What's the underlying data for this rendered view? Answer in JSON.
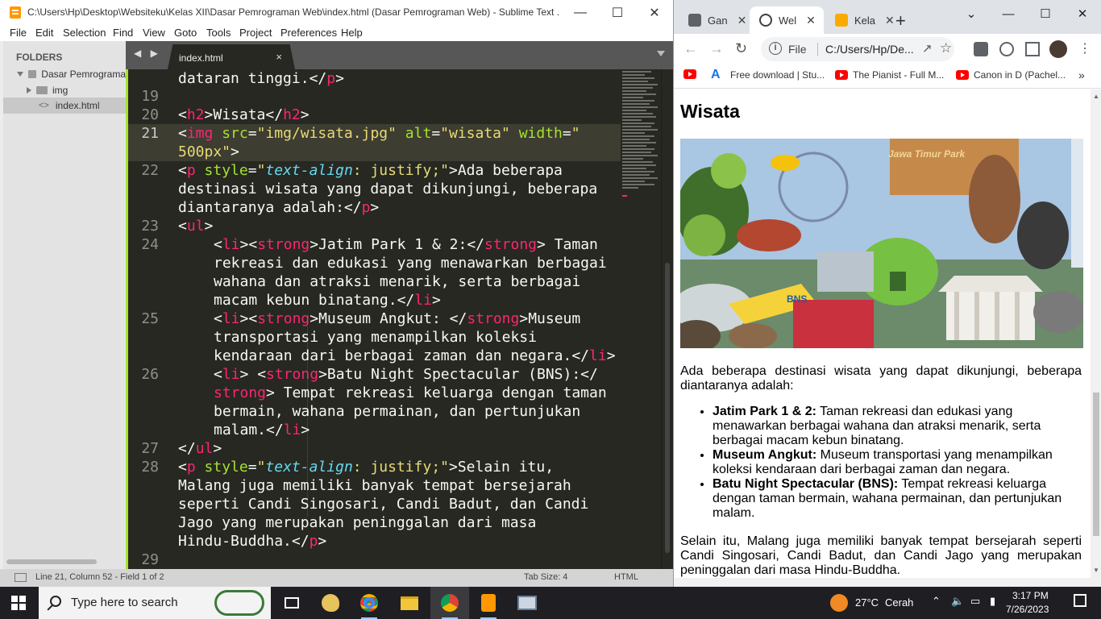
{
  "sublime": {
    "title": "C:\\Users\\Hp\\Desktop\\Websiteku\\Kelas XII\\Dasar Pemrograman Web\\index.html (Dasar Pemrograman Web) - Sublime Text ...",
    "menu": [
      "File",
      "Edit",
      "Selection",
      "Find",
      "View",
      "Goto",
      "Tools",
      "Project",
      "Preferences",
      "Help"
    ],
    "sidebar": {
      "header": "FOLDERS",
      "items": [
        {
          "label": "Dasar Pemrograma"
        },
        {
          "label": "img"
        },
        {
          "label": "index.html"
        }
      ]
    },
    "tab": {
      "label": "index.html",
      "close": "×"
    },
    "status": {
      "position": "Line 21, Column 52 - Field 1 of 2",
      "tab_size": "Tab Size: 4",
      "syntax": "HTML"
    }
  },
  "code": {
    "l0_t": "dataran tinggi.",
    "l0_c1": "</",
    "l0_c2": "p",
    "l0_c3": ">",
    "n19": "19",
    "n20": "20",
    "l20_a": "<",
    "l20_b": "h2",
    "l20_c": ">Wisata</",
    "l20_d": "h2",
    "l20_e": ">",
    "n21": "21",
    "l21_a": "<",
    "l21_b": "img",
    "l21_c": " src",
    "l21_d": "=",
    "l21_e": "\"img/wisata.jpg\"",
    "l21_f": " alt",
    "l21_g": "=",
    "l21_h": "\"wisata\"",
    "l21_i": " width",
    "l21_j": "=",
    "l21_k": "\"",
    "l21w_a": "500px\"",
    "l21w_b": ">",
    "n22": "22",
    "l22_a": "<",
    "l22_b": "p",
    "l22_c": " style",
    "l22_d": "=",
    "l22_e": "\"",
    "l22_f": "text-align",
    "l22_g": ": justify;",
    "l22_h": "\"",
    "l22_i": ">Ada beberapa",
    "l22w1": "destinasi wisata yang dapat dikunjungi, beberapa",
    "l22w2_a": "diantaranya adalah:</",
    "l22w2_b": "p",
    "l22w2_c": ">",
    "n23": "23",
    "l23_a": "<",
    "l23_b": "ul",
    "l23_c": ">",
    "n24": "24",
    "l24_a": "<",
    "l24_b": "li",
    "l24_c": "><",
    "l24_d": "strong",
    "l24_e": ">Jatim Park 1 & 2:</",
    "l24_f": "strong",
    "l24_g": "> Taman",
    "l24w1": "rekreasi dan edukasi yang menawarkan berbagai",
    "l24w2": "wahana dan atraksi menarik, serta berbagai",
    "l24w3_a": "macam kebun binatang.</",
    "l24w3_b": "li",
    "l24w3_c": ">",
    "n25": "25",
    "l25_a": "<",
    "l25_b": "li",
    "l25_c": "><",
    "l25_d": "strong",
    "l25_e": ">Museum Angkut: </",
    "l25_f": "strong",
    "l25_g": ">Museum",
    "l25w1": "transportasi yang menampilkan koleksi",
    "l25w2_a": "kendaraan dari berbagai zaman dan negara.</",
    "l25w2_b": "li",
    "l25w2_c": ">",
    "n26": "26",
    "l26_a": "<",
    "l26_b": "li",
    "l26_c": "> <",
    "l26_d": "strong",
    "l26_e": ">Batu Night Spectacular (BNS):</",
    "l26w1_a": "strong",
    "l26w1_b": "> Tempat rekreasi keluarga dengan taman",
    "l26w2": "bermain, wahana permainan, dan pertunjukan",
    "l26w3_a": "malam.</",
    "l26w3_b": "li",
    "l26w3_c": ">",
    "n27": "27",
    "l27_a": "</",
    "l27_b": "ul",
    "l27_c": ">",
    "n28": "28",
    "l28_a": "<",
    "l28_b": "p",
    "l28_c": " style",
    "l28_d": "=",
    "l28_e": "\"",
    "l28_f": "text-align",
    "l28_g": ": justify;",
    "l28_h": "\"",
    "l28_i": ">Selain itu,",
    "l28w1": "Malang juga memiliki banyak tempat bersejarah",
    "l28w2": "seperti Candi Singosari, Candi Badut, dan Candi",
    "l28w3": "Jago yang merupakan peninggalan dari masa",
    "l28w4_a": "Hindu-Buddha.</",
    "l28w4_b": "p",
    "l28w4_c": ">",
    "n29": "29"
  },
  "chrome": {
    "tabs": [
      {
        "label": "Gan",
        "favicon_color": "#5f6368"
      },
      {
        "label": "Wel",
        "favicon_color": "#3c4043"
      },
      {
        "label": "Kela",
        "favicon_color": "#f9ab00"
      }
    ],
    "new_tab": "+",
    "address": {
      "scheme": "File",
      "url": "C:/Users/Hp/De..."
    },
    "bookmarks": [
      {
        "label": ""
      },
      {
        "label": "Free download | Stu..."
      },
      {
        "label": "The Pianist - Full M..."
      },
      {
        "label": "Canon in D (Pachel..."
      }
    ],
    "bookmarks_more": "»"
  },
  "page": {
    "heading": "Wisata",
    "image_alt": "wisata",
    "image_sign": "Jawa Timur Park",
    "image_sign2": "BNS",
    "intro": "Ada beberapa destinasi wisata yang dapat dikunjungi, beberapa diantaranya adalah:",
    "list": [
      {
        "strong": "Jatim Park 1 & 2:",
        "text": " Taman rekreasi dan edukasi yang menawarkan berbagai wahana dan atraksi menarik, serta berbagai macam kebun binatang."
      },
      {
        "strong": "Museum Angkut:",
        "text": " Museum transportasi yang menampilkan koleksi kendaraan dari berbagai zaman dan negara."
      },
      {
        "strong": "Batu Night Spectacular (BNS):",
        "text": " Tempat rekreasi keluarga dengan taman bermain, wahana permainan, dan pertunjukan malam."
      }
    ],
    "outro": "Selain itu, Malang juga memiliki banyak tempat bersejarah seperti Candi Singosari, Candi Badut, dan Candi Jago yang merupakan peninggalan dari masa Hindu-Buddha."
  },
  "taskbar": {
    "search_placeholder": "Type here to search",
    "weather_temp": "27°C",
    "weather_text": "Cerah",
    "time": "3:17 PM",
    "date": "7/26/2023",
    "apps": [
      "task-view",
      "paint",
      "chrome",
      "file-explorer",
      "chrome-profile",
      "sublime-text",
      "remote-desktop"
    ]
  }
}
